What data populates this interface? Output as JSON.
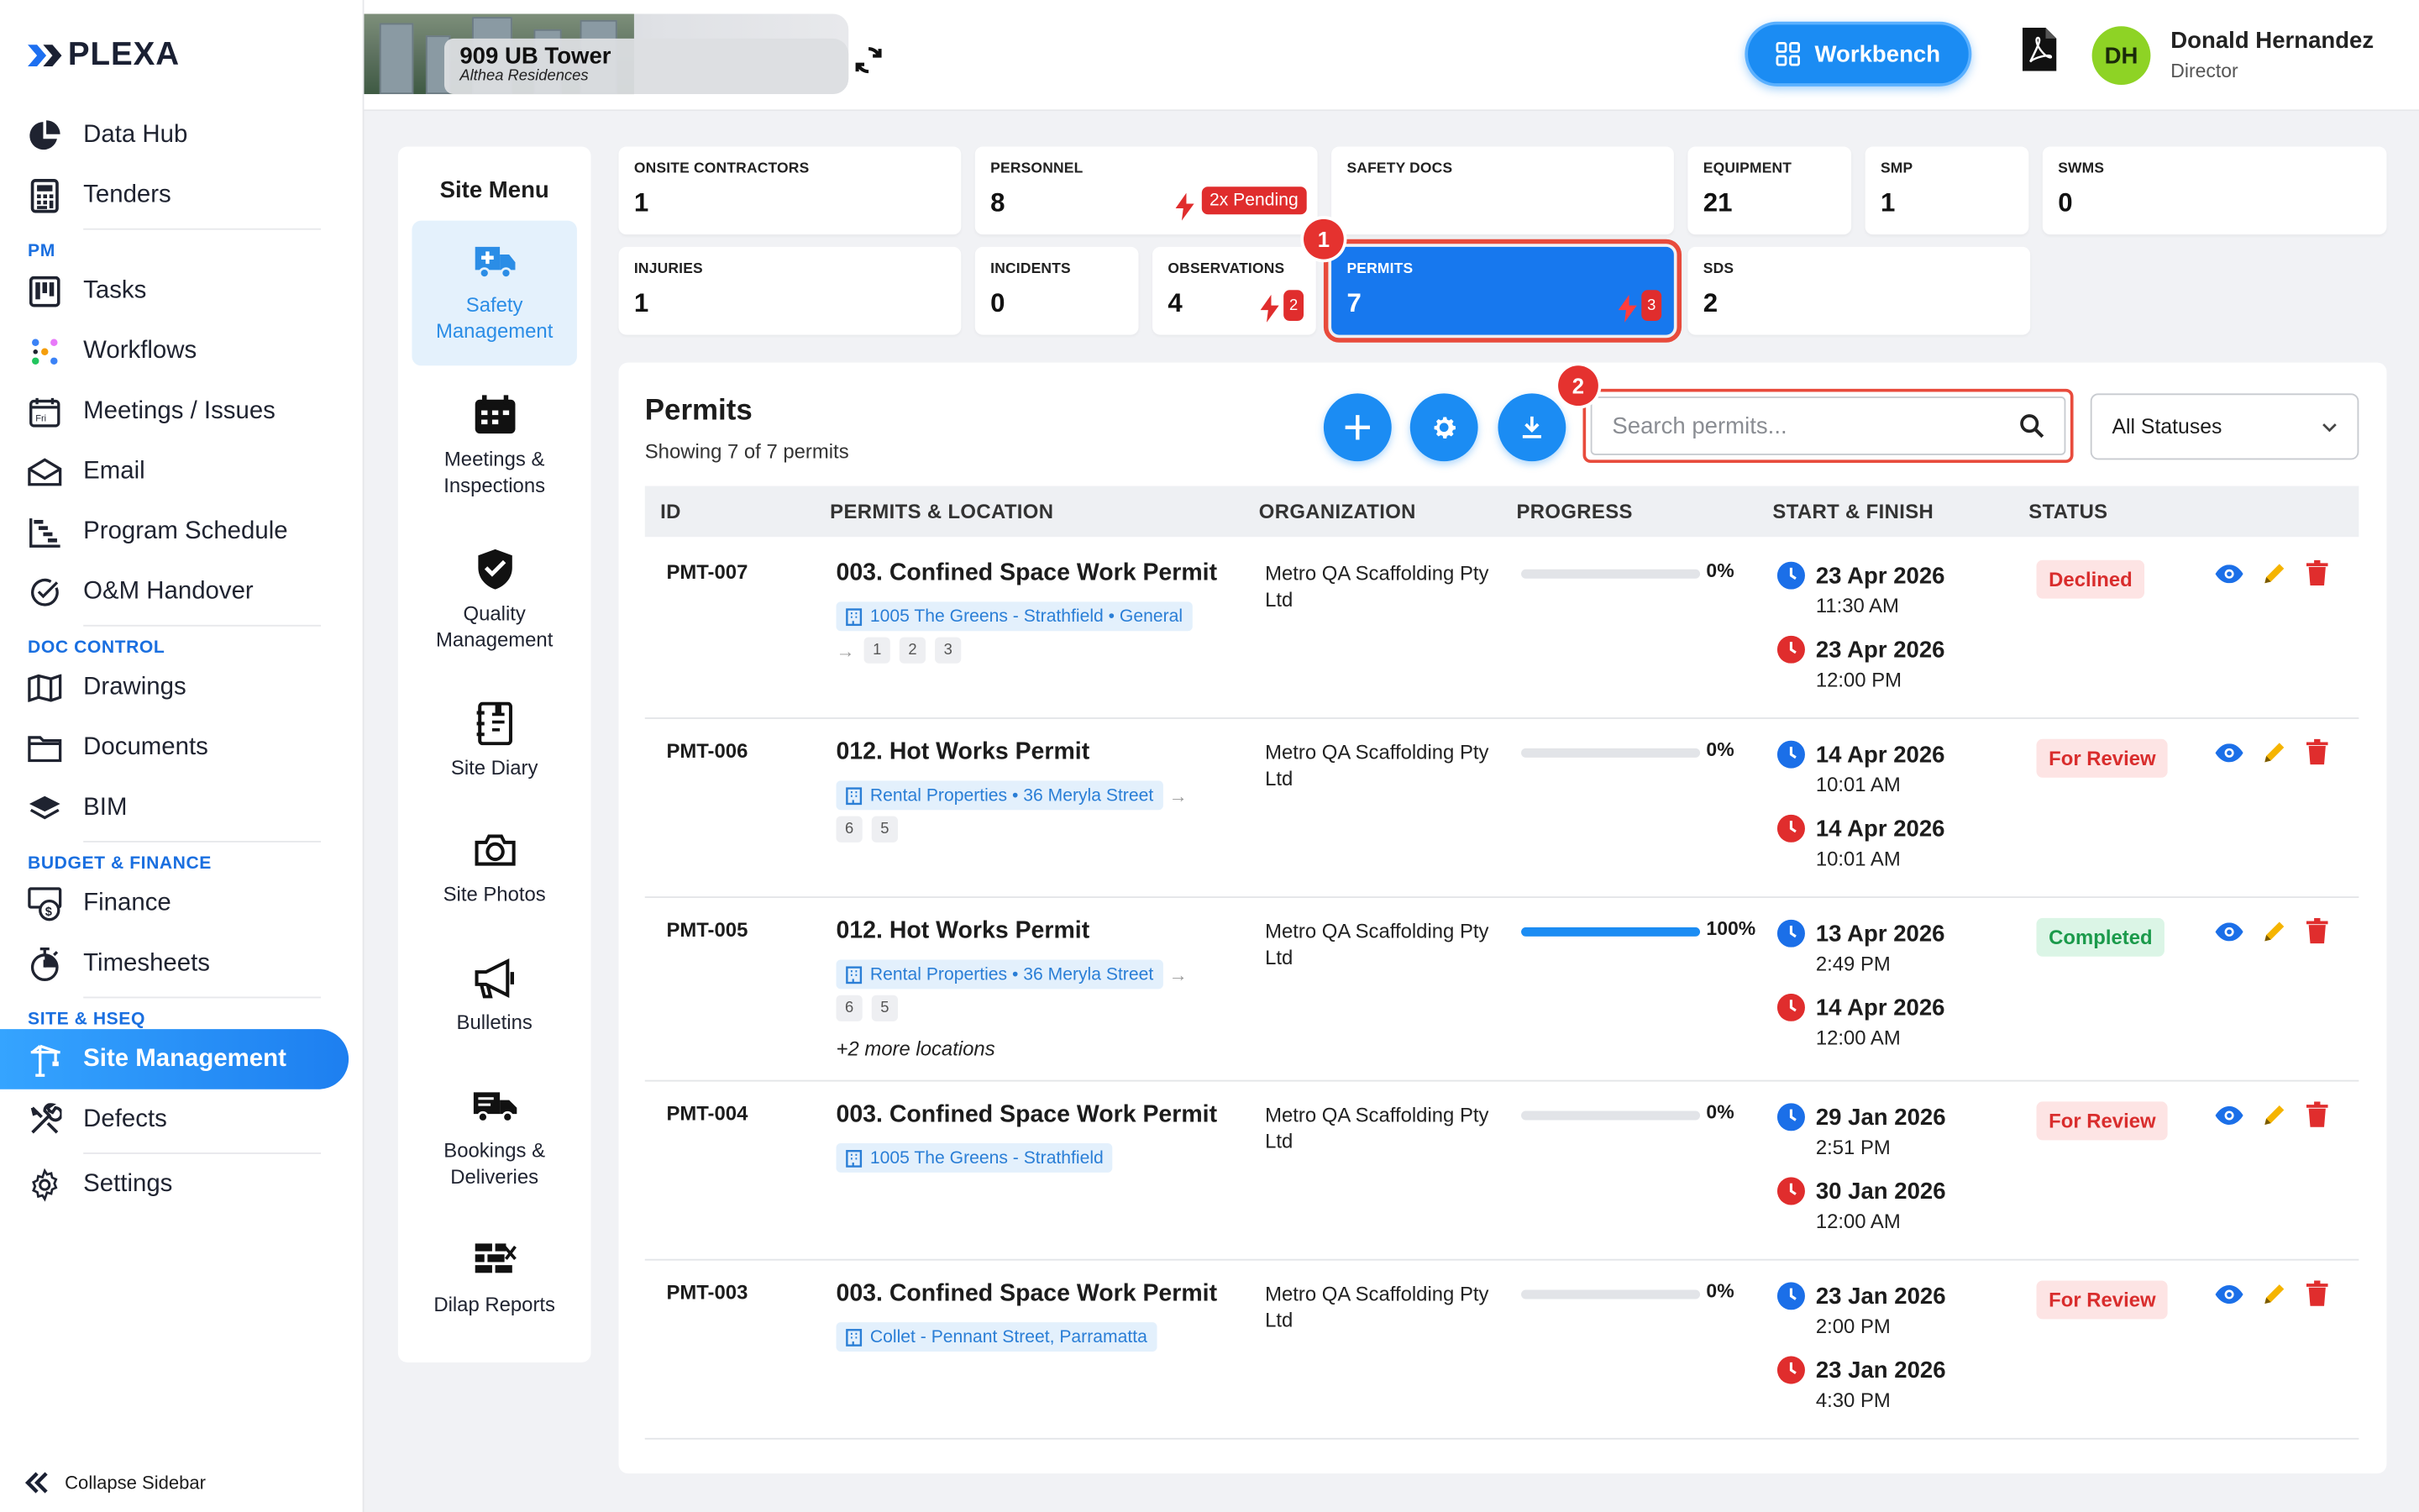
{
  "app": {
    "logo": "PLEXA"
  },
  "sidebar": {
    "top": [
      {
        "label": "Data Hub",
        "icon": "pie-chart-icon"
      },
      {
        "label": "Tenders",
        "icon": "calculator-icon"
      }
    ],
    "sections": [
      {
        "title": "PM",
        "items": [
          {
            "label": "Tasks",
            "icon": "kanban-icon"
          },
          {
            "label": "Workflows",
            "icon": "workflow-icon"
          },
          {
            "label": "Meetings / Issues",
            "icon": "calendar-icon"
          },
          {
            "label": "Email",
            "icon": "mail-icon"
          },
          {
            "label": "Program Schedule",
            "icon": "gantt-icon"
          },
          {
            "label": "O&M Handover",
            "icon": "check-circle-icon"
          }
        ]
      },
      {
        "title": "DOC CONTROL",
        "items": [
          {
            "label": "Drawings",
            "icon": "map-icon"
          },
          {
            "label": "Documents",
            "icon": "folder-icon"
          },
          {
            "label": "BIM",
            "icon": "layers-icon"
          }
        ]
      },
      {
        "title": "BUDGET & FINANCE",
        "items": [
          {
            "label": "Finance",
            "icon": "money-icon"
          },
          {
            "label": "Timesheets",
            "icon": "stopwatch-icon"
          }
        ]
      },
      {
        "title": "SITE & HSEQ",
        "items": [
          {
            "label": "Site Management",
            "icon": "crane-icon",
            "active": true
          },
          {
            "label": "Defects",
            "icon": "tools-icon"
          },
          {
            "label": "Settings",
            "icon": "gear-icon"
          }
        ]
      }
    ],
    "collapse_label": "Collapse Sidebar"
  },
  "topbar": {
    "project_name": "909 UB Tower",
    "project_sub": "Althea Residences",
    "workbench_label": "Workbench",
    "user_initials": "DH",
    "user_name": "Donald Hernandez",
    "user_role": "Director"
  },
  "site_menu": {
    "title": "Site Menu",
    "items": [
      {
        "label": "Safety Management",
        "icon": "ambulance-icon",
        "active": true
      },
      {
        "label": "Meetings & Inspections",
        "icon": "calendar-grid-icon"
      },
      {
        "label": "Quality Management",
        "icon": "shield-check-icon"
      },
      {
        "label": "Site Diary",
        "icon": "diary-icon"
      },
      {
        "label": "Site Photos",
        "icon": "camera-icon"
      },
      {
        "label": "Bulletins",
        "icon": "megaphone-icon"
      },
      {
        "label": "Bookings & Deliveries",
        "icon": "truck-icon"
      },
      {
        "label": "Dilap Reports",
        "icon": "brick-wall-icon"
      }
    ]
  },
  "stats": [
    {
      "label": "ONSITE CONTRACTORS",
      "value": "1"
    },
    {
      "label": "PERSONNEL",
      "value": "8",
      "pending": "2x Pending"
    },
    {
      "label": "SAFETY DOCS",
      "value": ""
    },
    {
      "label": "EQUIPMENT",
      "value": "21"
    },
    {
      "label": "SMP",
      "value": "1"
    },
    {
      "label": "SWMS",
      "value": "0"
    },
    {
      "label": "INJURIES",
      "value": "1"
    },
    {
      "label": "INCIDENTS",
      "value": "0"
    },
    {
      "label": "OBSERVATIONS",
      "value": "4",
      "badge": "2"
    },
    {
      "label": "PERMITS",
      "value": "7",
      "badge": "3",
      "selected": true
    },
    {
      "label": "SDS",
      "value": "2"
    }
  ],
  "steps": [
    "1",
    "2"
  ],
  "permits": {
    "title": "Permits",
    "subtitle": "Showing 7 of 7 permits",
    "search_placeholder": "Search permits...",
    "status_filter": "All Statuses",
    "columns": [
      "ID",
      "PERMITS & LOCATION",
      "ORGANIZATION",
      "PROGRESS",
      "START & FINISH",
      "STATUS"
    ],
    "rows": [
      {
        "id": "PMT-007",
        "title": "003. Confined Space Work Permit",
        "location": "1005 The Greens - Strathfield • General",
        "chips": [
          "1",
          "2",
          "3"
        ],
        "org": "Metro QA Scaffolding Pty Ltd",
        "progress": 0,
        "progress_label": "0%",
        "start_date": "23 Apr 2026",
        "start_time": "11:30 AM",
        "end_date": "23 Apr 2026",
        "end_time": "12:00 PM",
        "status": "Declined"
      },
      {
        "id": "PMT-006",
        "title": "012. Hot Works Permit",
        "location": "Rental Properties • 36 Meryla Street",
        "chips": [
          "6",
          "5"
        ],
        "org": "Metro QA Scaffolding Pty Ltd",
        "progress": 0,
        "progress_label": "0%",
        "start_date": "14 Apr 2026",
        "start_time": "10:01 AM",
        "end_date": "14 Apr 2026",
        "end_time": "10:01 AM",
        "status": "For Review"
      },
      {
        "id": "PMT-005",
        "title": "012. Hot Works Permit",
        "location": "Rental Properties • 36 Meryla Street",
        "chips": [
          "6",
          "5"
        ],
        "more": "+2 more locations",
        "org": "Metro QA Scaffolding Pty Ltd",
        "progress": 100,
        "progress_label": "100%",
        "start_date": "13 Apr 2026",
        "start_time": "2:49 PM",
        "end_date": "14 Apr 2026",
        "end_time": "12:00 AM",
        "status": "Completed"
      },
      {
        "id": "PMT-004",
        "title": "003. Confined Space Work Permit",
        "location": "1005 The Greens - Strathfield",
        "chips": [],
        "org": "Metro QA Scaffolding Pty Ltd",
        "progress": 0,
        "progress_label": "0%",
        "start_date": "29 Jan 2026",
        "start_time": "2:51 PM",
        "end_date": "30 Jan 2026",
        "end_time": "12:00 AM",
        "status": "For Review"
      },
      {
        "id": "PMT-003",
        "title": "003. Confined Space Work Permit",
        "location": "Collet - Pennant Street, Parramatta",
        "chips": [],
        "org": "Metro QA Scaffolding Pty Ltd",
        "progress": 0,
        "progress_label": "0%",
        "start_date": "23 Jan 2026",
        "start_time": "2:00 PM",
        "end_date": "23 Jan 2026",
        "end_time": "4:30 PM",
        "status": "For Review"
      }
    ]
  },
  "colors": {
    "accent": "#1b8cf3",
    "danger": "#e02d2d",
    "success": "#1b9a4b",
    "highlight": "#e84b3c"
  }
}
